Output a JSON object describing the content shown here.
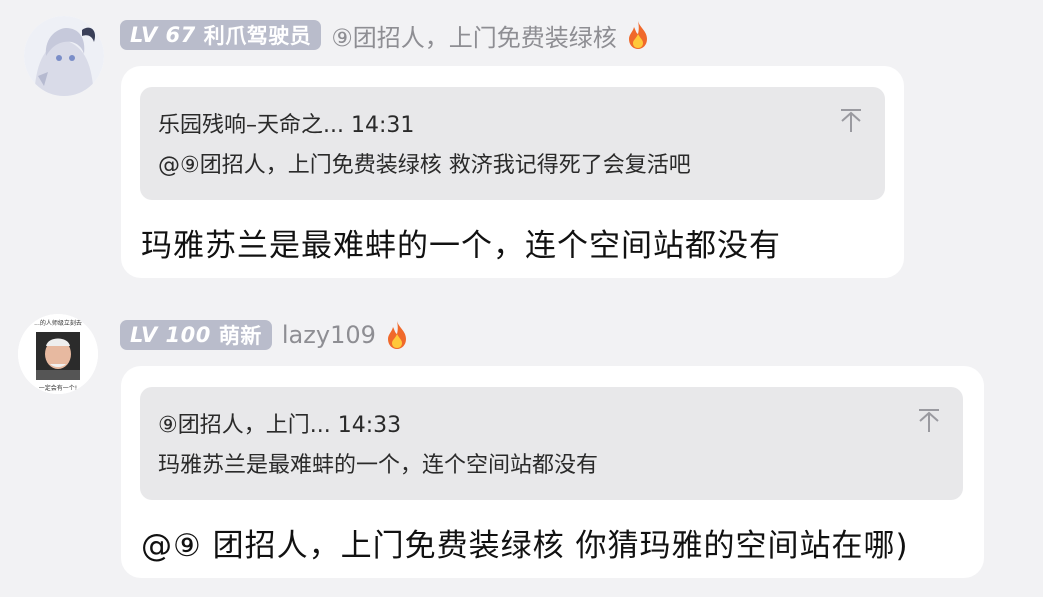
{
  "messages": [
    {
      "badge_level": "LV 67",
      "badge_title": "利爪驾驶员",
      "sender_name": "⑨团招人，上门免费装绿核",
      "quote": {
        "title": "乐园残响–天命之... 14:31",
        "text": "@⑨团招人，上门免费装绿核 救济我记得死了会复活吧"
      },
      "reply": "玛雅苏兰是最难蚌的一个，连个空间站都没有"
    },
    {
      "badge_level": "LV 100",
      "badge_title": "萌新",
      "sender_name": "lazy109",
      "avatar_caption_top": "...的人师级立刻去",
      "avatar_caption_bottom": "一定会有一个!",
      "quote": {
        "title": "⑨团招人，上门... 14:33",
        "text": "玛雅苏兰是最难蚌的一个，连个空间站都没有"
      },
      "reply": "@⑨ 团招人，上门免费装绿核 你猜玛雅的空间站在哪)"
    }
  ],
  "icons": {
    "collapse": "collapse-icon",
    "fire": "fire-icon"
  },
  "colors": {
    "background": "#f2f2f4",
    "badge": "#b9bccb",
    "bubble": "#ffffff",
    "quote": "#e8e8ea",
    "name": "#8e8e93"
  }
}
